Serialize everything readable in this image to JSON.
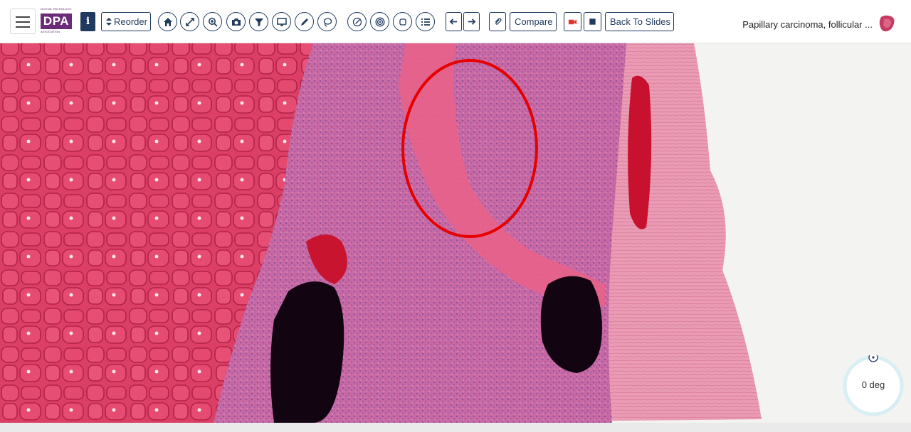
{
  "toolbar": {
    "logo_small": "DIGITAL PATHOLOGY",
    "logo_main": "DPA",
    "logo_assoc": "ASSOCIATION",
    "info_label": "i",
    "reorder_label": "Reorder",
    "compare_label": "Compare",
    "back_label": "Back To Slides"
  },
  "slide": {
    "title": "Papillary carcinoma, follicular ..."
  },
  "rotation": {
    "label": "0 deg"
  },
  "colors": {
    "accent": "#1e3a5f",
    "record": "#e3342f",
    "annotation": "#e60000"
  },
  "icons": [
    "menu-icon",
    "info-icon",
    "sort-icon",
    "home-icon",
    "fullscreen-icon",
    "zoom-icon",
    "camera-icon",
    "filter-icon",
    "monitor-icon",
    "pencil-icon",
    "lasso-icon",
    "draw-icon",
    "target-icon",
    "square-icon",
    "list-icon",
    "arrow-left-icon",
    "arrow-right-icon",
    "paperclip-icon",
    "video-icon",
    "stop-icon"
  ]
}
